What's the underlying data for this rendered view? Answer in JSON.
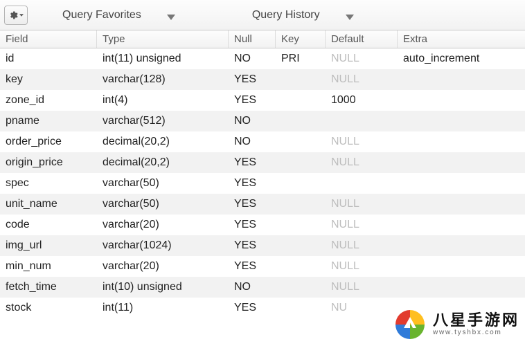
{
  "toolbar": {
    "favorites_label": "Query Favorites",
    "history_label": "Query History"
  },
  "columns": {
    "field": "Field",
    "type": "Type",
    "null": "Null",
    "key": "Key",
    "default": "Default",
    "extra": "Extra"
  },
  "rows": [
    {
      "field": "id",
      "type": "int(11) unsigned",
      "null": "NO",
      "key": "PRI",
      "default": "NULL",
      "default_is_null": true,
      "extra": "auto_increment"
    },
    {
      "field": "key",
      "type": "varchar(128)",
      "null": "YES",
      "key": "",
      "default": "NULL",
      "default_is_null": true,
      "extra": ""
    },
    {
      "field": "zone_id",
      "type": "int(4)",
      "null": "YES",
      "key": "",
      "default": "1000",
      "default_is_null": false,
      "extra": ""
    },
    {
      "field": "pname",
      "type": "varchar(512)",
      "null": "NO",
      "key": "",
      "default": "",
      "default_is_null": false,
      "extra": ""
    },
    {
      "field": "order_price",
      "type": "decimal(20,2)",
      "null": "NO",
      "key": "",
      "default": "NULL",
      "default_is_null": true,
      "extra": ""
    },
    {
      "field": "origin_price",
      "type": "decimal(20,2)",
      "null": "YES",
      "key": "",
      "default": "NULL",
      "default_is_null": true,
      "extra": ""
    },
    {
      "field": "spec",
      "type": "varchar(50)",
      "null": "YES",
      "key": "",
      "default": "",
      "default_is_null": false,
      "extra": ""
    },
    {
      "field": "unit_name",
      "type": "varchar(50)",
      "null": "YES",
      "key": "",
      "default": "NULL",
      "default_is_null": true,
      "extra": ""
    },
    {
      "field": "code",
      "type": "varchar(20)",
      "null": "YES",
      "key": "",
      "default": "NULL",
      "default_is_null": true,
      "extra": ""
    },
    {
      "field": "img_url",
      "type": "varchar(1024)",
      "null": "YES",
      "key": "",
      "default": "NULL",
      "default_is_null": true,
      "extra": ""
    },
    {
      "field": "min_num",
      "type": "varchar(20)",
      "null": "YES",
      "key": "",
      "default": "NULL",
      "default_is_null": true,
      "extra": ""
    },
    {
      "field": "fetch_time",
      "type": "int(10) unsigned",
      "null": "NO",
      "key": "",
      "default": "NULL",
      "default_is_null": true,
      "extra": ""
    },
    {
      "field": "stock",
      "type": "int(11)",
      "null": "YES",
      "key": "",
      "default": "NU",
      "default_is_null": true,
      "extra": ""
    }
  ],
  "watermark": {
    "title_cn": "八星手游网",
    "url": "www.tyshbx.com"
  }
}
